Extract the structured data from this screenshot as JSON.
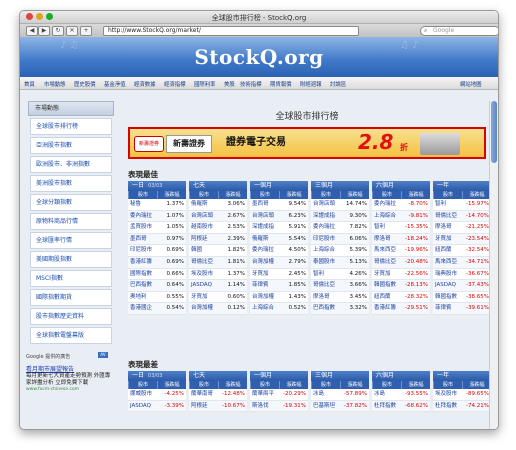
{
  "window": {
    "title": "全球股市排行榜 - StockQ.org"
  },
  "toolbar": {
    "url": "http://www.StockQ.org/market/",
    "search_placeholder": "Google"
  },
  "site": {
    "logo": "StockQ.org"
  },
  "nav": [
    "首頁",
    "市場動態",
    "歷史股價",
    "基金淨值",
    "經濟數據",
    "經濟指標",
    "國際利率",
    "美股",
    "技術指標",
    "期貨報價",
    "財經週報",
    "討論區"
  ],
  "nav_right": "網站地圖",
  "sidebar": {
    "header": "市場動態",
    "items": [
      "全球股市排行榜",
      "亞洲股市指數",
      "歐洲股市、非洲指數",
      "美洲股市指數",
      "全球分類指數",
      "原物料商品行情",
      "全球匯率行情",
      "美國期股指數",
      "MSCI指數",
      "國際指數期貨",
      "股市指數歷史資料",
      "全球指數電盤幕版"
    ]
  },
  "google_ads": {
    "label": "Google 提供的廣告",
    "ad_badge": "AV",
    "ad_title": "看月期市展望報告",
    "ad_body": "每月更新七大資產走勢預測 外匯專家詳盡分析 立即免費下載",
    "ad_url": "www.fxcm-chinese.com"
  },
  "main": {
    "page_title": "全球股市排行榜",
    "ad": {
      "logo": "新壽證券",
      "name": "新壽證券",
      "slogan": "證券電子交易",
      "number": "2.8",
      "unit": "折"
    },
    "section1": "表現最佳",
    "section2": "表現最差"
  },
  "columns": [
    {
      "period": "一日",
      "date": "03/03"
    },
    {
      "period": "七天",
      "date": ""
    },
    {
      "period": "一個月",
      "date": ""
    },
    {
      "period": "三個月",
      "date": ""
    },
    {
      "period": "六個月",
      "date": ""
    },
    {
      "period": "一年",
      "date": ""
    }
  ],
  "subheaders": [
    "股市",
    "漲跌幅"
  ],
  "best": [
    [
      [
        "秘魯",
        "1.37%"
      ],
      [
        "委內瑞拉",
        "1.07%"
      ],
      [
        "孟買股市",
        "1.05%"
      ],
      [
        "墨西哥",
        "0.97%"
      ],
      [
        "印尼股市",
        "0.69%"
      ],
      [
        "香港紅籌",
        "0.69%"
      ],
      [
        "國際指數",
        "0.66%"
      ],
      [
        "巴西指數",
        "0.64%"
      ],
      [
        "奧地利",
        "0.55%"
      ],
      [
        "香港國企",
        "0.54%"
      ]
    ],
    [
      [
        "俄羅斯",
        "3.06%"
      ],
      [
        "台灣店頭",
        "2.67%"
      ],
      [
        "越南股市",
        "2.53%"
      ],
      [
        "阿根廷",
        "2.39%"
      ],
      [
        "韓國",
        "1.82%"
      ],
      [
        "哥倫比亞",
        "1.81%"
      ],
      [
        "埃及股市",
        "1.37%"
      ],
      [
        "JASDAQ",
        "1.14%"
      ],
      [
        "牙買加",
        "0.60%"
      ],
      [
        "台灣加權",
        "0.12%"
      ]
    ],
    [
      [
        "墨西哥",
        "9.54%"
      ],
      [
        "台灣店頭",
        "6.23%"
      ],
      [
        "深證成指",
        "5.91%"
      ],
      [
        "俄羅斯",
        "5.54%"
      ],
      [
        "委內瑞拉",
        "4.50%"
      ],
      [
        "台灣加權",
        "2.79%"
      ],
      [
        "牙買加",
        "2.45%"
      ],
      [
        "菲律賓",
        "1.85%"
      ],
      [
        "台灣加權",
        "1.43%"
      ],
      [
        "上海綜合",
        "0.52%"
      ]
    ],
    [
      [
        "台灣店頭",
        "14.74%"
      ],
      [
        "深證成指",
        "9.30%"
      ],
      [
        "委內瑞拉",
        "7.82%"
      ],
      [
        "印尼股市",
        "6.06%"
      ],
      [
        "上海綜合",
        "5.39%"
      ],
      [
        "泰國股市",
        "5.13%"
      ],
      [
        "智利",
        "4.26%"
      ],
      [
        "哥倫比亞",
        "3.66%"
      ],
      [
        "摩洛哥",
        "3.45%"
      ],
      [
        "巴西指數",
        "3.32%"
      ]
    ],
    [
      [
        "委內瑞拉",
        "-8.70%"
      ],
      [
        "上海綜合",
        "-9.81%"
      ],
      [
        "智利",
        "-15.35%"
      ],
      [
        "摩洛哥",
        "-18.24%"
      ],
      [
        "馬來西亞",
        "-19.96%"
      ],
      [
        "哥倫比亞",
        "-20.48%"
      ],
      [
        "牙買加",
        "-22.56%"
      ],
      [
        "韓國指數",
        "-28.13%"
      ],
      [
        "紐西蘭",
        "-28.32%"
      ],
      [
        "香港紅籌",
        "-29.51%"
      ]
    ],
    [
      [
        "智利",
        "-15.97%"
      ],
      [
        "哥倫比亞",
        "-14.70%"
      ],
      [
        "摩洛哥",
        "-21.25%"
      ],
      [
        "牙買加",
        "-23.54%"
      ],
      [
        "紐西蘭",
        "-32.54%"
      ],
      [
        "馬來西亞",
        "-34.71%"
      ],
      [
        "瑞典股市",
        "-36.67%"
      ],
      [
        "JASDAQ",
        "-37.43%"
      ],
      [
        "韓國指數",
        "-38.65%"
      ],
      [
        "菲律賓",
        "-39.61%"
      ]
    ]
  ],
  "worst": [
    [
      [
        "挪威股市",
        "-4.25%"
      ],
      [
        "JASDAQ",
        "-3.39%"
      ]
    ],
    [
      [
        "蘭華南哥",
        "-12.48%"
      ],
      [
        "阿根廷",
        "-10.67%"
      ]
    ],
    [
      [
        "蘭華兩平",
        "-20.29%"
      ],
      [
        "斯洛伐",
        "-19.31%"
      ]
    ],
    [
      [
        "冰島",
        "-57.89%"
      ],
      [
        "巴基斯坦",
        "-37.82%"
      ]
    ],
    [
      [
        "冰島",
        "-93.55%"
      ],
      [
        "杜拜指數",
        "-68.62%"
      ]
    ],
    [
      [
        "埃及股市",
        "-89.65%"
      ],
      [
        "杜拜指數",
        "-74.21%"
      ]
    ]
  ],
  "colors": {
    "accent": "#2d62b3",
    "negative": "#dd0000",
    "ad_border": "#dd0000"
  }
}
